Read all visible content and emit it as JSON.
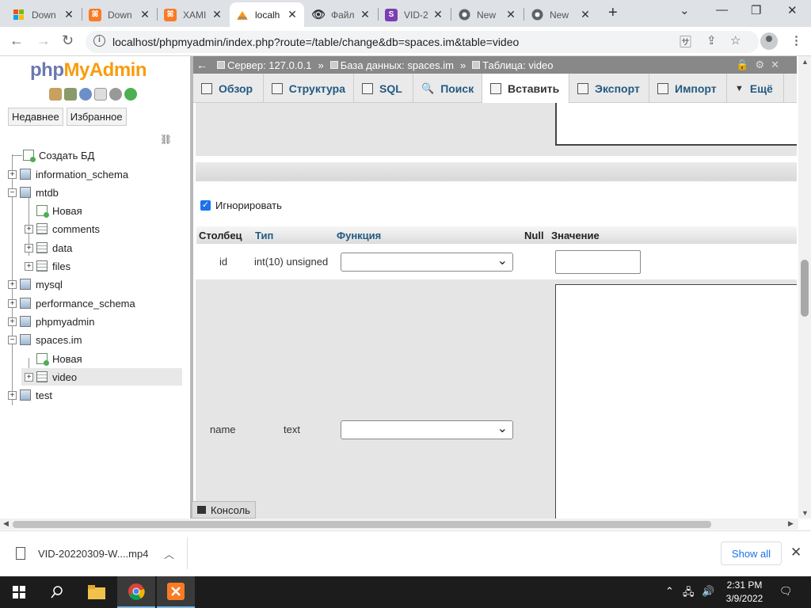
{
  "browser": {
    "tabs": [
      {
        "title": "Down",
        "icon": "windows-icon",
        "color": "#f25022"
      },
      {
        "title": "Down",
        "icon": "xampp-icon",
        "color": "#fb7a24"
      },
      {
        "title": "XAMI",
        "icon": "xampp-icon",
        "color": "#fb7a24"
      },
      {
        "title": "localh",
        "icon": "phpmyadmin-icon",
        "color": "#f89c0e"
      },
      {
        "title": "Файл",
        "icon": "eye-icon",
        "color": "#444444"
      },
      {
        "title": "VID-2",
        "icon": "s-icon",
        "color": "#7b3fb0"
      },
      {
        "title": "New",
        "icon": "chrome-icon",
        "color": "#5f6368"
      },
      {
        "title": "New",
        "icon": "chrome-icon",
        "color": "#5f6368"
      }
    ],
    "url": "localhost/phpmyadmin/index.php?route=/table/change&db=spaces.im&table=video"
  },
  "nav": {
    "logo_php": "php",
    "logo_my": "MyAdmin",
    "recent": "Недавнее",
    "favorites": "Избранное",
    "tree": {
      "create_db": "Создать БД",
      "information_schema": "information_schema",
      "mtdb": "mtdb",
      "mtdb_new": "Новая",
      "comments": "comments",
      "data": "data",
      "files": "files",
      "mysql": "mysql",
      "performance_schema": "performance_schema",
      "phpmyadmin": "phpmyadmin",
      "spaces_im": "spaces.im",
      "spaces_new": "Новая",
      "video": "video",
      "test": "test"
    }
  },
  "breadcrumb": {
    "server": "Сервер: 127.0.0.1",
    "database": "База данных: spaces.im",
    "table": "Таблица: video",
    "sep": "»"
  },
  "menu": {
    "browse": "Обзор",
    "structure": "Структура",
    "sql": "SQL",
    "search": "Поиск",
    "insert": "Вставить",
    "export": "Экспорт",
    "import": "Импорт",
    "more": "Ещё"
  },
  "form": {
    "ignore_label": "Игнорировать",
    "headers": {
      "column": "Столбец",
      "type": "Тип",
      "function": "Функция",
      "null": "Null",
      "value": "Значение"
    },
    "rows": [
      {
        "column": "id",
        "type": "int(10) unsigned"
      },
      {
        "column": "name",
        "type": "text"
      }
    ]
  },
  "console": "Консоль",
  "download": {
    "file": "VID-20220309-W....mp4",
    "show_all": "Show all"
  },
  "taskbar": {
    "time": "2:31 PM",
    "date": "3/9/2022"
  }
}
